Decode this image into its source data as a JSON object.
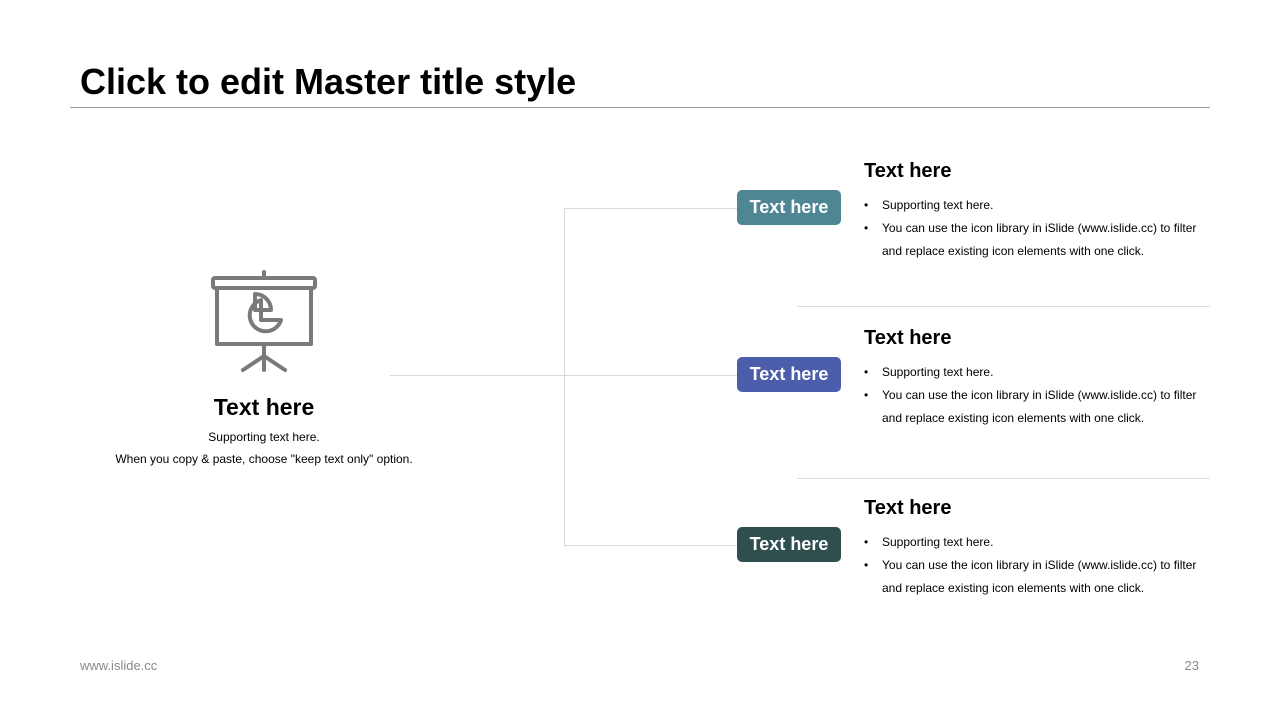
{
  "slide": {
    "title": "Click to edit Master title style",
    "footer_left": "www.islide.cc",
    "page_number": "23"
  },
  "left": {
    "icon": "presentation-pie-chart-icon",
    "heading": "Text here",
    "line1": "Supporting text here.",
    "line2": "When you copy & paste, choose \"keep text only\" option."
  },
  "items": [
    {
      "pill_label": "Text here",
      "pill_color": "#4f8693",
      "heading": "Text here",
      "bullet1": "Supporting text here.",
      "bullet2": "You can use the icon library in iSlide  (www.islide.cc) to filter and replace existing icon elements with one click."
    },
    {
      "pill_label": "Text here",
      "pill_color": "#4b5dab",
      "heading": "Text here",
      "bullet1": "Supporting text here.",
      "bullet2": "You can use the icon library in iSlide  (www.islide.cc) to filter and replace existing icon elements with one click."
    },
    {
      "pill_label": "Text here",
      "pill_color": "#2f4f4f",
      "heading": "Text here",
      "bullet1": "Supporting text here.",
      "bullet2": "You can use the icon library in iSlide  (www.islide.cc) to filter and replace existing icon elements with one click."
    }
  ]
}
